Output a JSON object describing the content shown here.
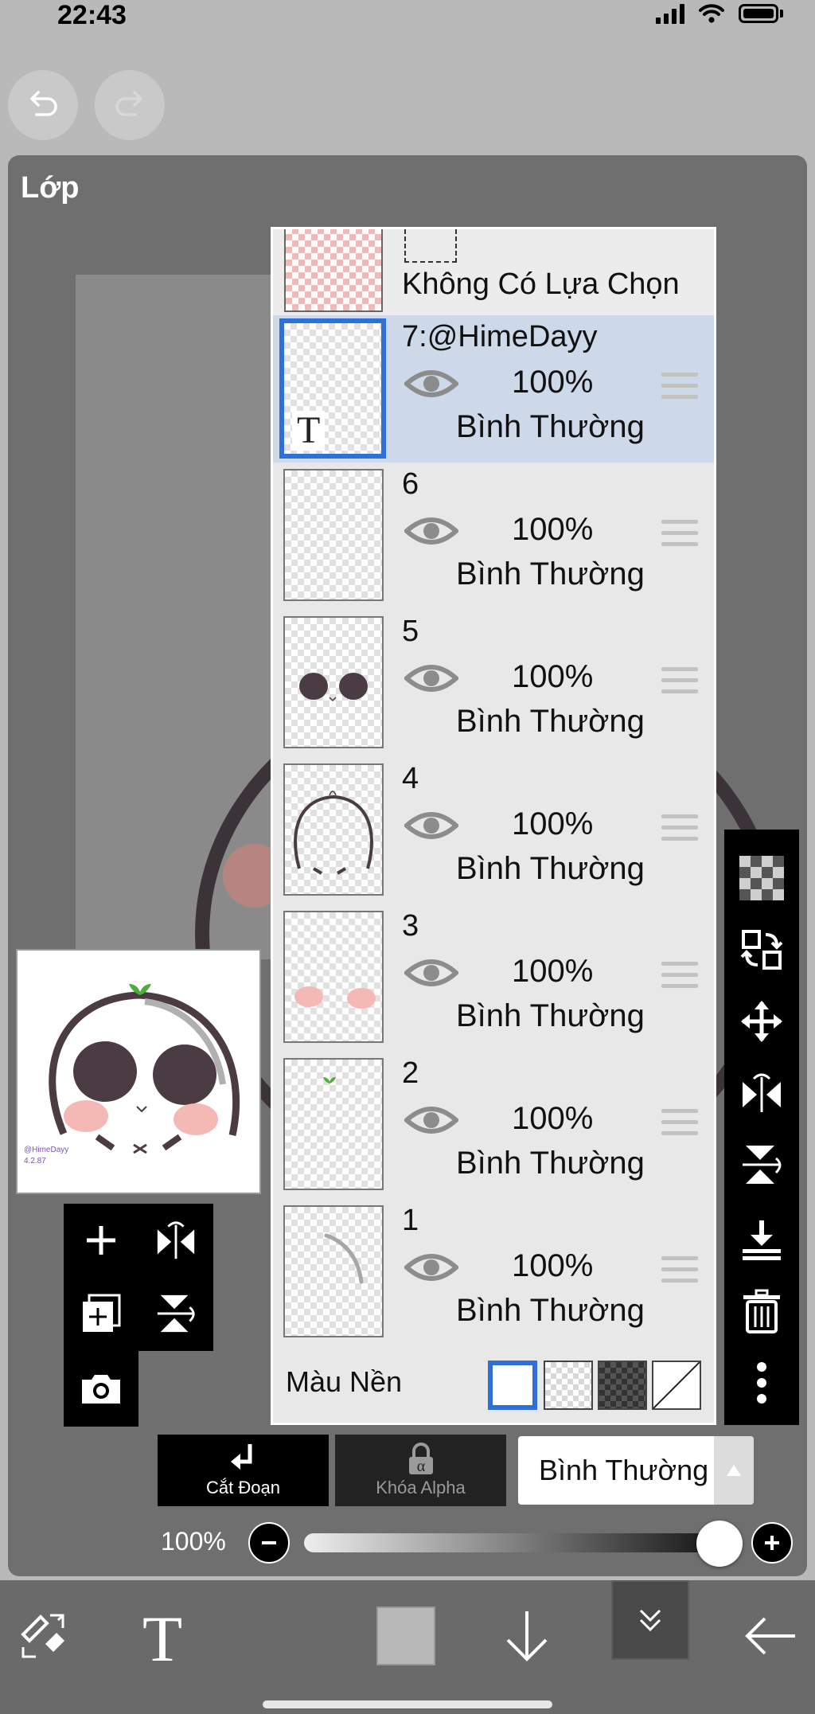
{
  "status_bar": {
    "time": "22:43"
  },
  "panel": {
    "title": "Lớp"
  },
  "selection": {
    "label": "Không Có Lựa Chọn"
  },
  "layers": [
    {
      "name": "7:@HimeDayy",
      "opacity": "100%",
      "blend": "Bình Thường",
      "active": true,
      "thumb_icon": "T"
    },
    {
      "name": "6",
      "opacity": "100%",
      "blend": "Bình Thường",
      "active": false
    },
    {
      "name": "5",
      "opacity": "100%",
      "blend": "Bình Thường",
      "active": false
    },
    {
      "name": "4",
      "opacity": "100%",
      "blend": "Bình Thường",
      "active": false
    },
    {
      "name": "3",
      "opacity": "100%",
      "blend": "Bình Thường",
      "active": false
    },
    {
      "name": "2",
      "opacity": "100%",
      "blend": "Bình Thường",
      "active": false
    },
    {
      "name": "1",
      "opacity": "100%",
      "blend": "Bình Thường",
      "active": false
    }
  ],
  "background_color": {
    "label": "Màu Nền",
    "options": [
      "white",
      "transparent-light",
      "transparent-dark",
      "none"
    ],
    "selected": "white"
  },
  "preview": {
    "watermark_line1": "@HimeDayy",
    "watermark_line2": "4.2.87"
  },
  "buttons": {
    "clipping_label": "Cắt Đoạn",
    "alpha_lock_label": "Khóa Alpha"
  },
  "blend_mode": {
    "value": "Bình Thường"
  },
  "opacity": {
    "value": "100%",
    "level": 1.0
  },
  "right_tools": [
    "transparency-icon",
    "transform-icon",
    "move-icon",
    "flip-horizontal-icon",
    "flip-vertical-icon",
    "merge-down-icon",
    "trash-icon",
    "more-icon"
  ],
  "left_tools": [
    "add-layer-icon",
    "flip-horizontal-icon",
    "duplicate-layer-icon",
    "flip-vertical-icon",
    "camera-icon"
  ],
  "bottom_bar": [
    "tool-swap-icon",
    "text-tool-icon",
    "color-swatch",
    "down-arrow-icon",
    "collapse-icon",
    "back-arrow-icon"
  ],
  "colors": {
    "accent": "#2e6fd8",
    "active_row": "#cdd8e8",
    "panel": "#6f6f6f",
    "toolbar": "#6a6a6a"
  }
}
